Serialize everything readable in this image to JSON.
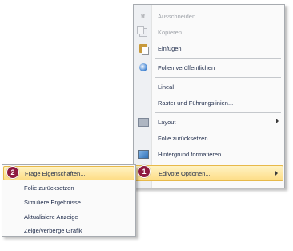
{
  "context_menu": {
    "items": [
      {
        "label": "Ausschneiden",
        "icon": "scissors-icon",
        "enabled": false
      },
      {
        "label": "Kopieren",
        "icon": "copy-icon",
        "enabled": false
      },
      {
        "label": "Einfügen",
        "icon": "paste-icon",
        "enabled": true
      },
      {
        "label": "Folien veröffentlichen",
        "icon": "publish-icon",
        "enabled": true
      },
      {
        "label": "Lineal",
        "enabled": true
      },
      {
        "label": "Raster und Führungslinien...",
        "enabled": true
      },
      {
        "label": "Layout",
        "icon": "layout-icon",
        "enabled": true,
        "has_submenu": true
      },
      {
        "label": "Folie zurücksetzen",
        "enabled": true
      },
      {
        "label": "Hintergrund formatieren...",
        "icon": "background-icon",
        "enabled": true
      },
      {
        "label": "EdiVote Optionen...",
        "enabled": true,
        "has_submenu": true,
        "highlighted": true
      }
    ]
  },
  "submenu": {
    "items": [
      {
        "label": "Frage Eigenschaften...",
        "highlighted": true
      },
      {
        "label": "Folie zurücksetzen"
      },
      {
        "label": "Simuliere Ergebnisse"
      },
      {
        "label": "Aktualisiere Anzeige"
      },
      {
        "label": "Zeige/verberge Grafik"
      }
    ]
  },
  "badges": {
    "one": "1",
    "two": "2"
  },
  "colors": {
    "highlight": "#fddd86",
    "badge": "#8e1a3f",
    "menu_bg": "#fafafa"
  }
}
